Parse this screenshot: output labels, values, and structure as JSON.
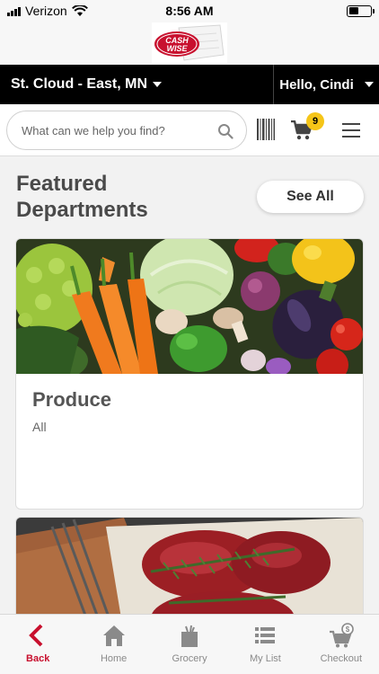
{
  "status_bar": {
    "carrier": "Verizon",
    "time": "8:56 AM"
  },
  "logo": {
    "text": "CASH WISE"
  },
  "store_bar": {
    "store_name": "St. Cloud - East, MN",
    "greeting": "Hello, Cindi"
  },
  "search": {
    "placeholder": "What can we help you find?"
  },
  "cart": {
    "count": "9"
  },
  "featured": {
    "title_line1": "Featured",
    "title_line2": "Departments",
    "see_all_label": "See All"
  },
  "departments": [
    {
      "title": "Produce",
      "subtitle": "All"
    }
  ],
  "bottom_nav": {
    "items": [
      {
        "label": "Back",
        "icon": "back-chevron-icon"
      },
      {
        "label": "Home",
        "icon": "home-icon"
      },
      {
        "label": "Grocery",
        "icon": "grocery-bag-icon"
      },
      {
        "label": "My List",
        "icon": "list-icon"
      },
      {
        "label": "Checkout",
        "icon": "checkout-cart-icon"
      }
    ]
  },
  "colors": {
    "brand_red": "#c8102e",
    "badge_yellow": "#f5c518",
    "bar_black": "#000000"
  }
}
